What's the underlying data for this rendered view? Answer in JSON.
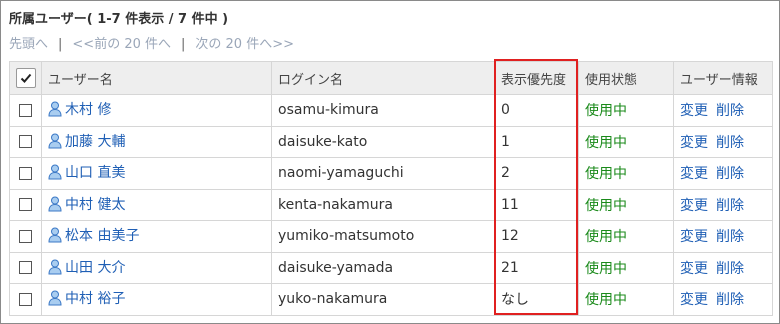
{
  "title": "所属ユーザー( 1-7 件表示 / 7 件中 )",
  "pager": {
    "first": "先頭へ",
    "prev": "<<前の 20 件へ",
    "next": "次の 20 件へ>>"
  },
  "columns": {
    "user_name": "ユーザー名",
    "login_name": "ログイン名",
    "display_priority": "表示優先度",
    "status": "使用状態",
    "user_info": "ユーザー情報"
  },
  "rows": [
    {
      "name": "木村 修",
      "login": "osamu-kimura",
      "priority": "0",
      "status": "使用中",
      "edit": "変更",
      "delete": "削除"
    },
    {
      "name": "加藤 大輔",
      "login": "daisuke-kato",
      "priority": "1",
      "status": "使用中",
      "edit": "変更",
      "delete": "削除"
    },
    {
      "name": "山口 直美",
      "login": "naomi-yamaguchi",
      "priority": "2",
      "status": "使用中",
      "edit": "変更",
      "delete": "削除"
    },
    {
      "name": "中村 健太",
      "login": "kenta-nakamura",
      "priority": "11",
      "status": "使用中",
      "edit": "変更",
      "delete": "削除"
    },
    {
      "name": "松本 由美子",
      "login": "yumiko-matsumoto",
      "priority": "12",
      "status": "使用中",
      "edit": "変更",
      "delete": "削除"
    },
    {
      "name": "山田 大介",
      "login": "daisuke-yamada",
      "priority": "21",
      "status": "使用中",
      "edit": "変更",
      "delete": "削除"
    },
    {
      "name": "中村 裕子",
      "login": "yuko-nakamura",
      "priority": "なし",
      "status": "使用中",
      "edit": "変更",
      "delete": "削除"
    }
  ],
  "icons": {
    "header_checkbox": "checkmark-icon",
    "user": "user-icon"
  },
  "colors": {
    "link": "#1f5fb5",
    "status_active": "#1a8a1a",
    "highlight_border": "#e02020",
    "header_bg": "#eeeeee"
  }
}
